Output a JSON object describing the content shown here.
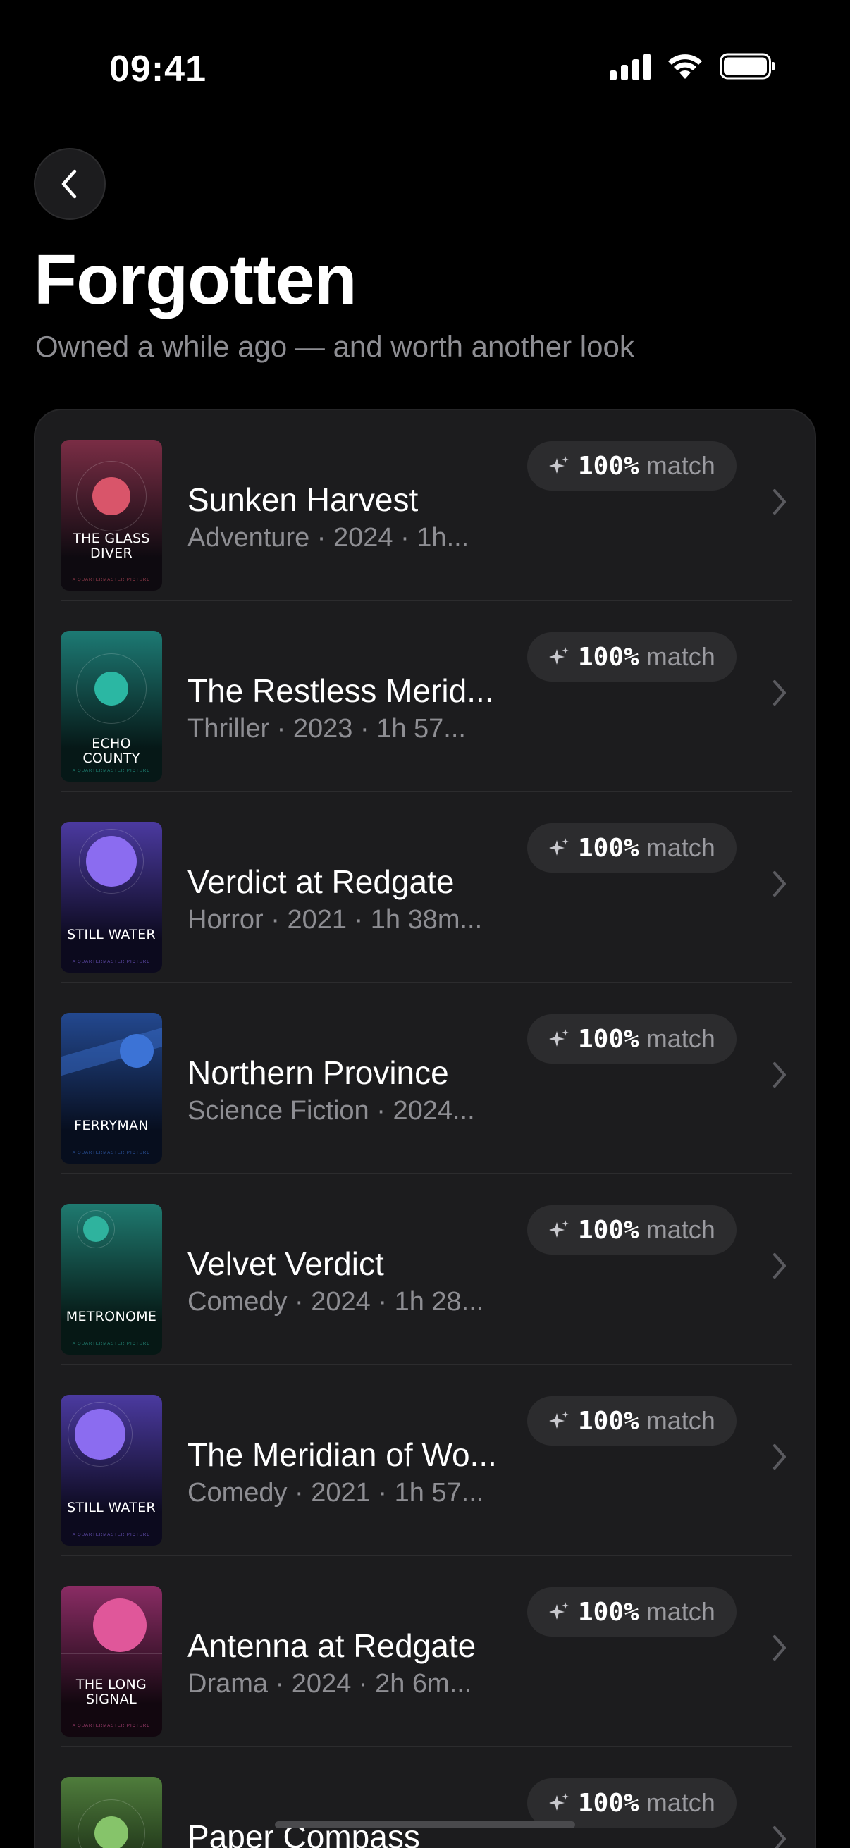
{
  "status_bar": {
    "time": "09:41"
  },
  "header": {
    "title": "Forgotten",
    "subtitle": "Owned a while ago — and worth another look"
  },
  "match_word": "match",
  "items": [
    {
      "title": "Sunken Harvest",
      "meta": "Adventure · 2024 · 1h...",
      "match": "100%",
      "poster_title": "THE GLASS DIVER",
      "poster_credit": "A QUARTERMASTER PICTURE",
      "poster_top": "#7a2d45",
      "poster_bottom": "#0e0a10",
      "poster_accent": "#d9556a"
    },
    {
      "title": "The Restless Merid...",
      "meta": "Thriller · 2023 · 1h 57...",
      "match": "100%",
      "poster_title": "ECHO COUNTY",
      "poster_credit": "A QUARTERMASTER PICTURE",
      "poster_top": "#1d7a74",
      "poster_bottom": "#061817",
      "poster_accent": "#2bb7a3"
    },
    {
      "title": "Verdict at Redgate",
      "meta": "Horror · 2021 · 1h 38m...",
      "match": "100%",
      "poster_title": "STILL WATER",
      "poster_credit": "A QUARTERMASTER PICTURE",
      "poster_top": "#4b3aa0",
      "poster_bottom": "#0c0a1e",
      "poster_accent": "#8b6cf0"
    },
    {
      "title": "Northern Province",
      "meta": "Science Fiction · 2024...",
      "match": "100%",
      "poster_title": "FERRYMAN",
      "poster_credit": "A QUARTERMASTER PICTURE",
      "poster_top": "#23488f",
      "poster_bottom": "#070e1e",
      "poster_accent": "#3c73d6"
    },
    {
      "title": "Velvet Verdict",
      "meta": "Comedy · 2024 · 1h 28...",
      "match": "100%",
      "poster_title": "METRONOME",
      "poster_credit": "A QUARTERMASTER PICTURE",
      "poster_top": "#1f7a70",
      "poster_bottom": "#061815",
      "poster_accent": "#2fb39e"
    },
    {
      "title": "The Meridian of Wo...",
      "meta": "Comedy · 2021 · 1h 57...",
      "match": "100%",
      "poster_title": "STILL WATER",
      "poster_credit": "A QUARTERMASTER PICTURE",
      "poster_top": "#4b3aa0",
      "poster_bottom": "#0c0a1e",
      "poster_accent": "#8b6cf0"
    },
    {
      "title": "Antenna at Redgate",
      "meta": "Drama · 2024 · 2h 6m...",
      "match": "100%",
      "poster_title": "THE LONG SIGNAL",
      "poster_credit": "A QUARTERMASTER PICTURE",
      "poster_top": "#8a2c64",
      "poster_bottom": "#12070f",
      "poster_accent": "#e0579a"
    },
    {
      "title": "Paper Compass",
      "meta": "",
      "match": "100%",
      "poster_title": "",
      "poster_credit": "",
      "poster_top": "#4f7d3c",
      "poster_bottom": "#0c160a",
      "poster_accent": "#86c46a"
    }
  ],
  "colors": {
    "background": "#000000",
    "card": "#1c1c1e",
    "secondary_text": "#8e8e93",
    "badge": "#2c2c2e"
  }
}
